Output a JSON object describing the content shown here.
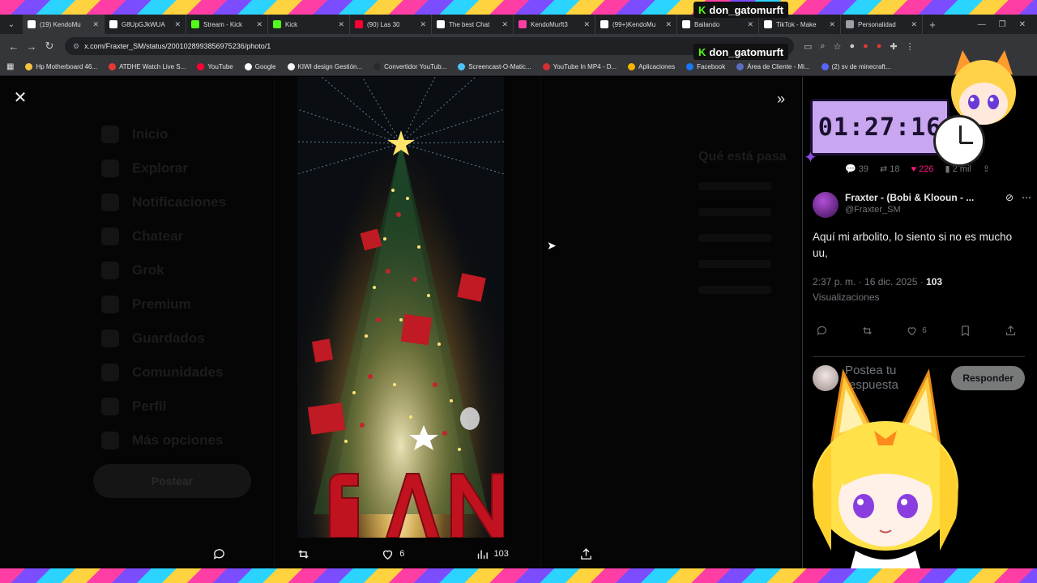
{
  "tabs": [
    {
      "label": "(19) KendoMu",
      "icon": "x-logo-icon",
      "color": "#ffffff"
    },
    {
      "label": "G8UpGJkWUA",
      "icon": "x-logo-icon",
      "color": "#ffffff"
    },
    {
      "label": "Stream - Kick",
      "icon": "kick-icon",
      "color": "#53fc18"
    },
    {
      "label": "Kick",
      "icon": "kick-icon",
      "color": "#53fc18"
    },
    {
      "label": "(90) Las 30",
      "icon": "youtube-icon",
      "color": "#ff0033"
    },
    {
      "label": "The best Chat",
      "icon": "chat-icon",
      "color": "#ffffff"
    },
    {
      "label": "KendoMurft3",
      "icon": "app-icon",
      "color": "#ff3ea5"
    },
    {
      "label": "(99+)KendoMu",
      "icon": "tiktok-icon",
      "color": "#ffffff"
    },
    {
      "label": "Bailando",
      "icon": "tiktok-icon",
      "color": "#ffffff"
    },
    {
      "label": "TikTok - Make",
      "icon": "tiktok-icon",
      "color": "#ffffff"
    },
    {
      "label": "Personalidad",
      "icon": "globe-icon",
      "color": "#9aa0a6"
    }
  ],
  "url": "x.com/Fraxter_SM/status/2001028993856975236/photo/1",
  "bookmarks": [
    {
      "label": "Hp Motherboard 46...",
      "color": "#f5c542"
    },
    {
      "label": "ATDHE Watch Live S...",
      "color": "#e53935"
    },
    {
      "label": "YouTube",
      "color": "#ff0033"
    },
    {
      "label": "Google",
      "color": "#ffffff"
    },
    {
      "label": "KIWI design Gestión...",
      "color": "#f5f5f5"
    },
    {
      "label": "Convertidor YouTub...",
      "color": "#2a2a2a"
    },
    {
      "label": "Screencast-O-Matic...",
      "color": "#4fc3f7"
    },
    {
      "label": "YouTube In MP4 - D...",
      "color": "#d32f2f"
    },
    {
      "label": "Aplicaciones",
      "color": "#f4b400"
    },
    {
      "label": "Facebook",
      "color": "#1877f2"
    },
    {
      "label": "Área de Cliente - Mi...",
      "color": "#5c6bc0"
    },
    {
      "label": "(2) sv de minecraft...",
      "color": "#5865f2"
    }
  ],
  "ghost_nav": [
    "Inicio",
    "Explorar",
    "Notificaciones",
    "Chatear",
    "Grok",
    "Premium",
    "Guardados",
    "Comunidades",
    "Perfil",
    "Más opciones"
  ],
  "ghost_post_label": "Postear",
  "ghost_right_title": "Qué está pasa",
  "media_actions": {
    "views": "103",
    "likes": "6"
  },
  "sidebar": {
    "prev_stats": {
      "replies": "39",
      "reposts": "18",
      "likes": "226",
      "views": "2 mil"
    },
    "display_name": "Fraxter - (Bobi & Klooun - ...",
    "handle": "@Fraxter_SM",
    "text": "Aquí mi arbolito, lo siento si no es mucho uu,",
    "time": "2:37 p. m. · 16 dic. 2025 · ",
    "views_count": "103",
    "views_label": "Visualizaciones",
    "likes": "6",
    "reply_placeholder": "Postea tu respuesta",
    "reply_button": "Responder"
  },
  "overlay": {
    "kick_username": "don_gatomurft",
    "timer": "01:27:16"
  },
  "colors": {
    "accent_like": "#f91880",
    "kick_green": "#53fc18",
    "timer_bg": "#c9a6f0"
  }
}
